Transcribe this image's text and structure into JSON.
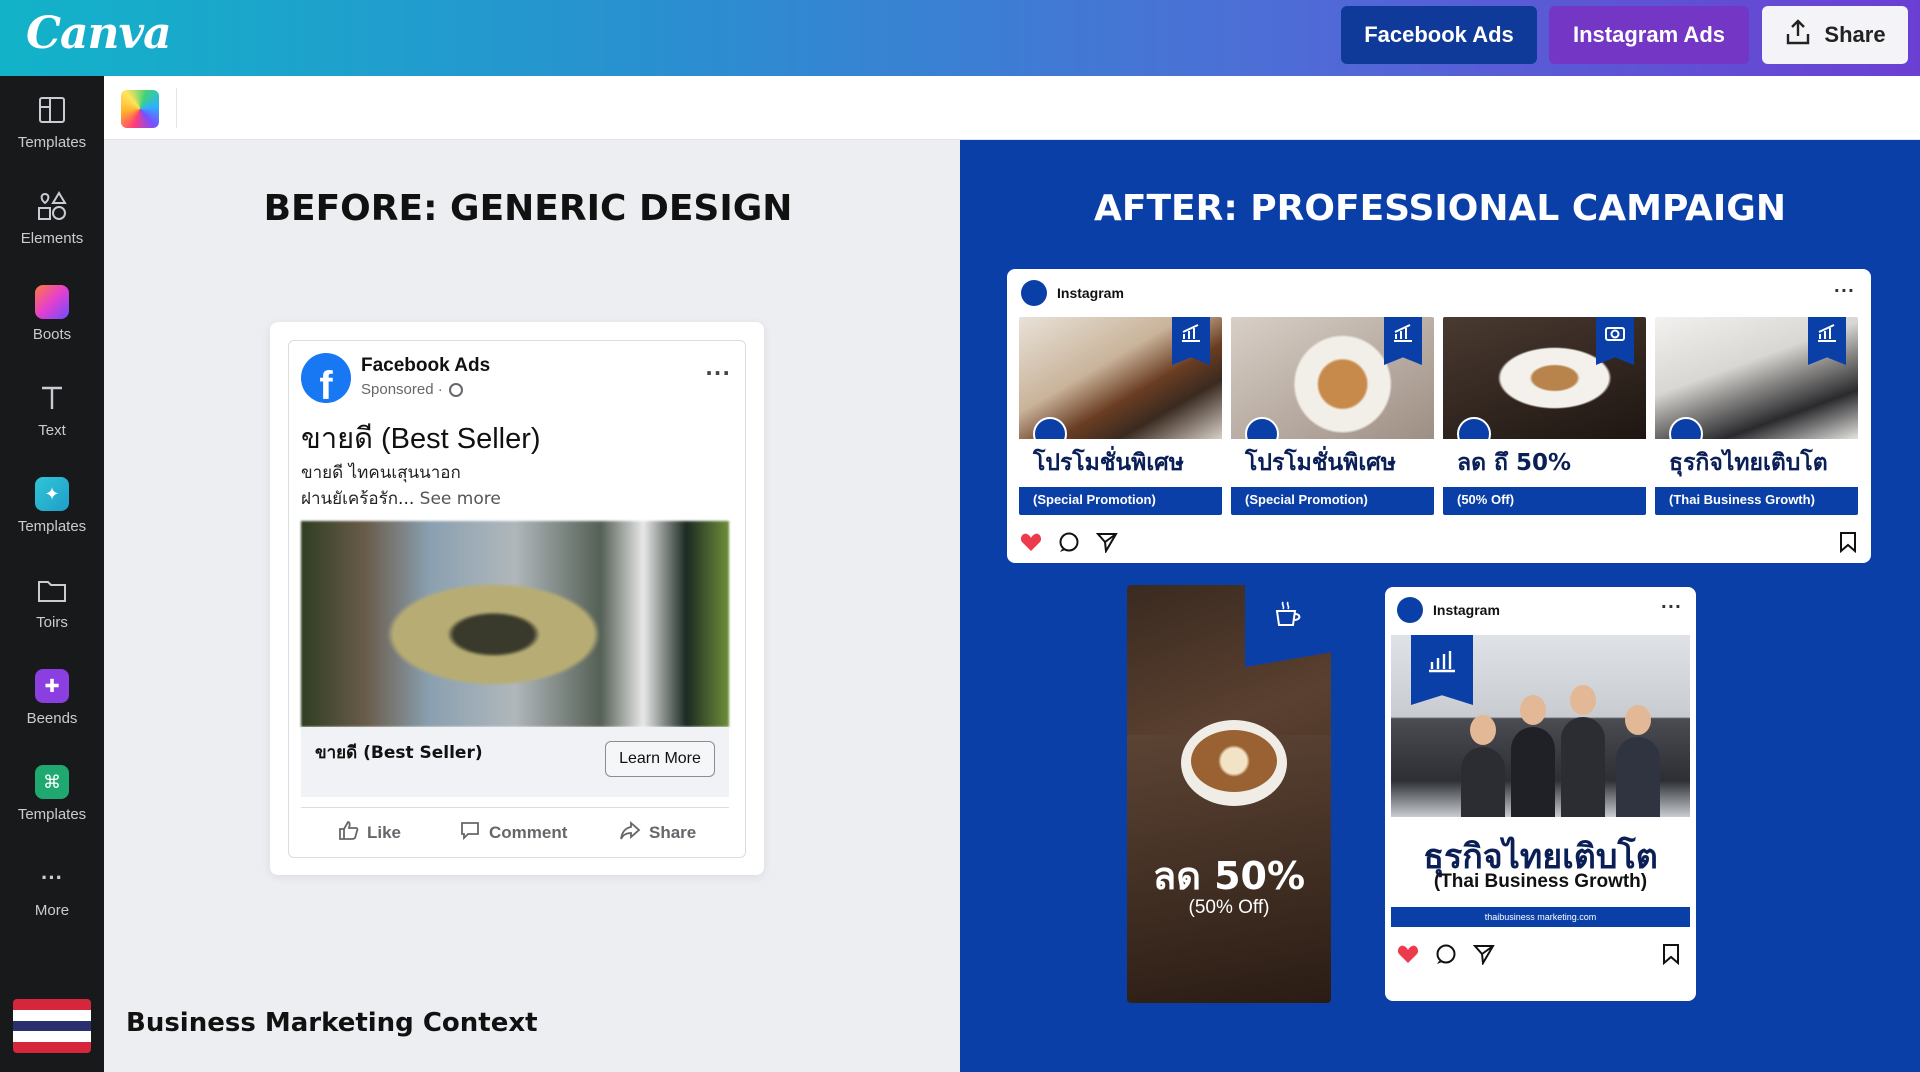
{
  "header": {
    "logo": "Canva",
    "buttons": {
      "facebook_ads": "Facebook Ads",
      "instagram_ads": "Instagram Ads",
      "share": "Share"
    }
  },
  "sidebar": {
    "items": [
      {
        "label": "Templates",
        "icon": "layout-icon"
      },
      {
        "label": "Elements",
        "icon": "shapes-icon"
      },
      {
        "label": "Boots",
        "icon": "gradient-app-icon"
      },
      {
        "label": "Text",
        "icon": "text-icon"
      },
      {
        "label": "Templates",
        "icon": "magic-icon"
      },
      {
        "label": "Toirs",
        "icon": "folder-icon"
      },
      {
        "label": "Beends",
        "icon": "brand-icon"
      },
      {
        "label": "Templates",
        "icon": "apps-icon"
      },
      {
        "label": "More",
        "icon": "more-icon"
      }
    ]
  },
  "colors": {
    "brand_blue": "#0b3fa8",
    "facebook_blue": "#1877f2",
    "header_gradient_start": "#12b3c9",
    "header_gradient_end": "#6b3fd4"
  },
  "left": {
    "title": "BEFORE: GENERIC DESIGN",
    "context_label": "Business Marketing Context",
    "fb_ad": {
      "page_name": "Facebook Ads",
      "sponsored": "Sponsored ·",
      "headline": "ขายดี (Best Seller)",
      "body_line1": "ขายดี ไทคนเสุนนาอก",
      "body_line2": "ฝานยัเคร้อรัก...",
      "see_more": "See more",
      "cta_text": "ขายดี (Best Seller)",
      "cta_button": "Learn More",
      "actions": {
        "like": "Like",
        "comment": "Comment",
        "share": "Share"
      }
    }
  },
  "right": {
    "title": "AFTER: PROFESSIONAL CAMPAIGN",
    "ig_feed": {
      "account": "Instagram",
      "posts": [
        {
          "title": "โปรโมชั่นพิเศษ",
          "subtitle": "(Special Promotion)"
        },
        {
          "title": "โปรโมชั่นพิเศษ",
          "subtitle": "(Special Promotion)"
        },
        {
          "title": "ลด ถึ 50%",
          "subtitle": "(50% Off)"
        },
        {
          "title": "ธุรกิจไทยเติบโต",
          "subtitle": "(Thai Business Growth)"
        }
      ]
    },
    "story": {
      "big": "ลด 50%",
      "small": "(50% Off)"
    },
    "ig_post": {
      "account": "Instagram",
      "title": "ธุรกิจไทยเติบโต",
      "subtitle": "(Thai Business Growth)",
      "url": "thaibusiness marketing.com"
    }
  }
}
